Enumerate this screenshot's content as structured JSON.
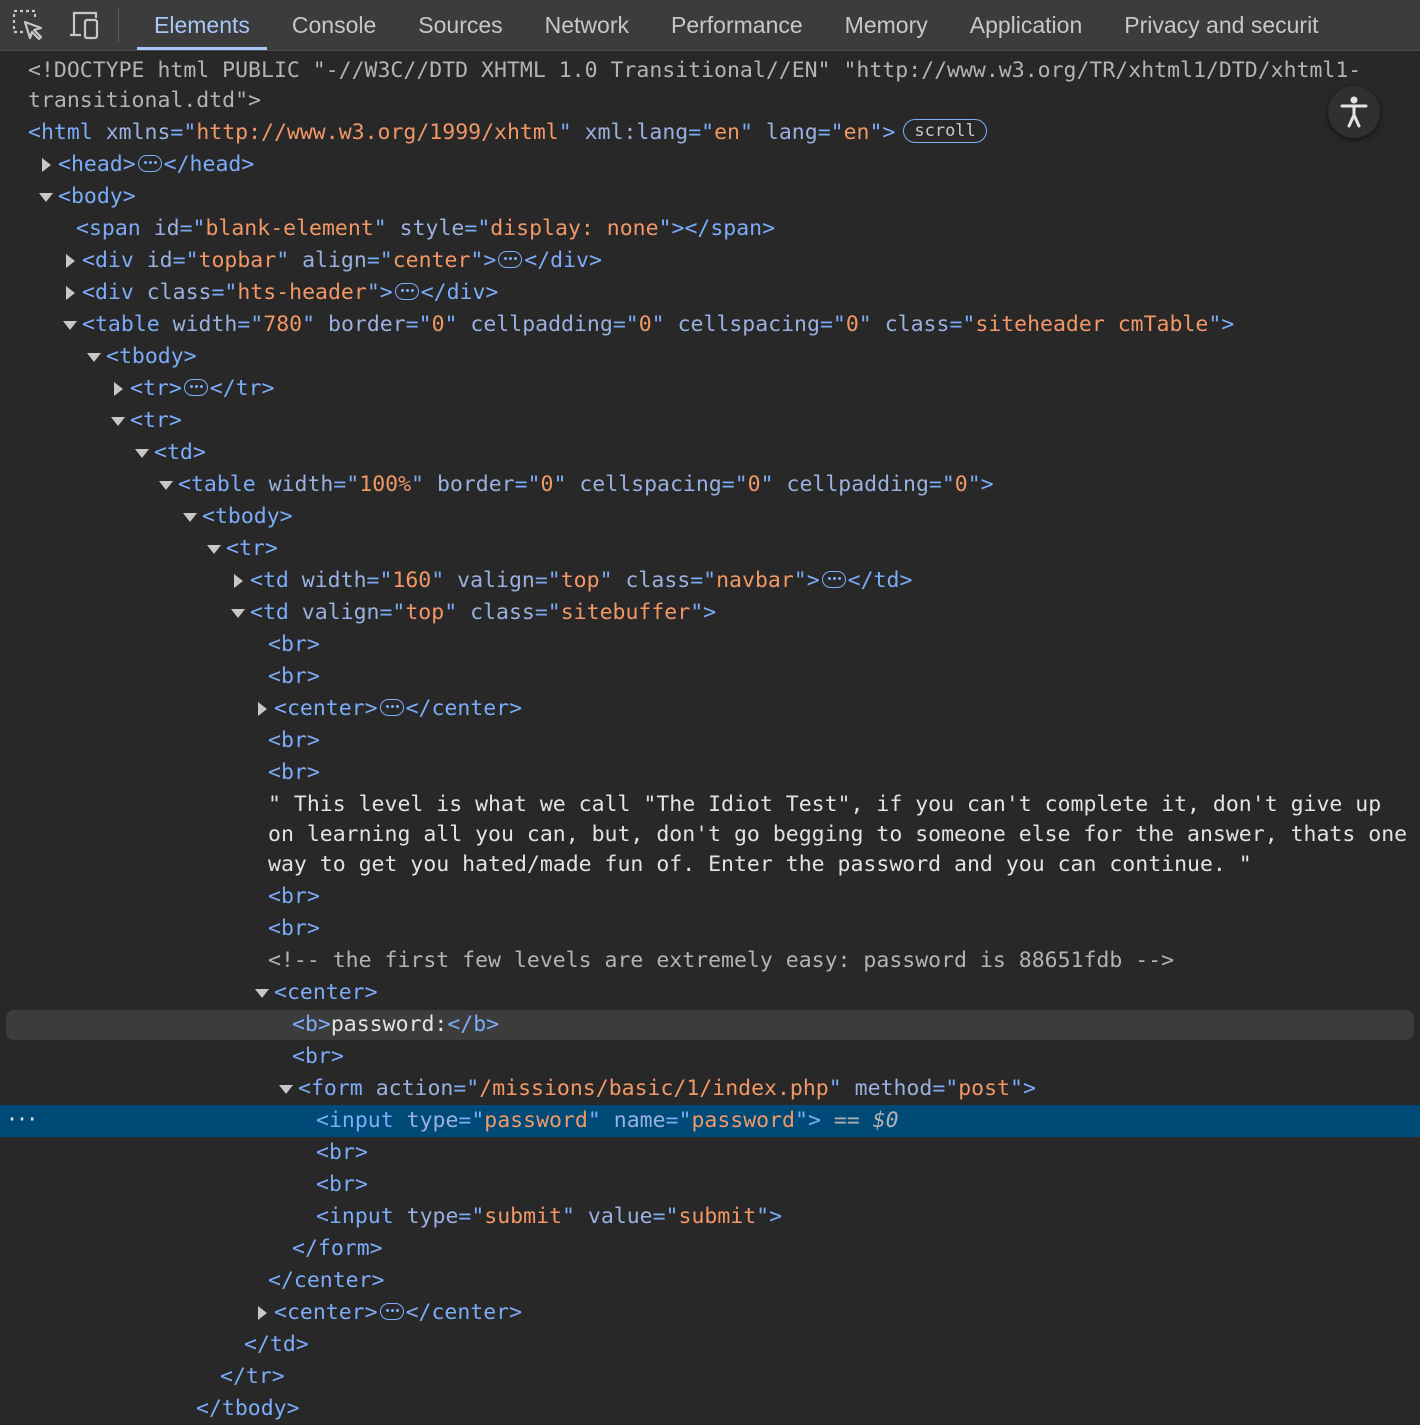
{
  "toolbar": {
    "inspect_icon": "inspect-element-icon",
    "device_icon": "device-toolbar-icon",
    "tabs": [
      {
        "label": "Elements",
        "active": true
      },
      {
        "label": "Console"
      },
      {
        "label": "Sources"
      },
      {
        "label": "Network"
      },
      {
        "label": "Performance"
      },
      {
        "label": "Memory"
      },
      {
        "label": "Application"
      },
      {
        "label": "Privacy and securit"
      }
    ]
  },
  "tree": {
    "doctype_1": "<!DOCTYPE html PUBLIC \"-//W3C//DTD XHTML 1.0 Transitional//EN\" \"http://www.w3.org/TR/xhtml1/DTD/xhtml1-",
    "doctype_2": "transitional.dtd\">",
    "html_xmlns": "http://www.w3.org/1999/xhtml",
    "html_xmllang": "en",
    "html_lang": "en",
    "scroll_badge": "scroll",
    "span_id": "blank-element",
    "span_style": "display: none",
    "topbar_id": "topbar",
    "topbar_align": "center",
    "header_class": "hts-header",
    "table_width": "780",
    "table_border": "0",
    "table_cellpadding": "0",
    "table_cellspacing": "0",
    "table_class": "siteheader cmTable",
    "inner_width": "100%",
    "inner_border": "0",
    "inner_cellspacing": "0",
    "inner_cellpadding": "0",
    "navbar_width": "160",
    "navbar_valign": "top",
    "navbar_class": "navbar",
    "buffer_valign": "top",
    "buffer_class": "sitebuffer",
    "text_node": "\" This level is what we call \"The Idiot Test\", if you can't complete it, don't give up on learning all you can, but, don't go begging to someone else for the answer, thats one way to get you hated/made fun of. Enter the password and you can continue. \"",
    "comment": "<!-- the first few levels are extremely easy: password is 88651fdb -->",
    "b_text": "password:",
    "form_action": "/missions/basic/1/index.php",
    "form_method": "post",
    "input_type": "password",
    "input_name": "password",
    "selected_marker": "== ",
    "selected_var": "$0",
    "submit_type": "submit",
    "submit_value": "submit",
    "selected_dots": "···"
  },
  "overlay": {
    "accessibility_icon": "accessibility-icon"
  }
}
